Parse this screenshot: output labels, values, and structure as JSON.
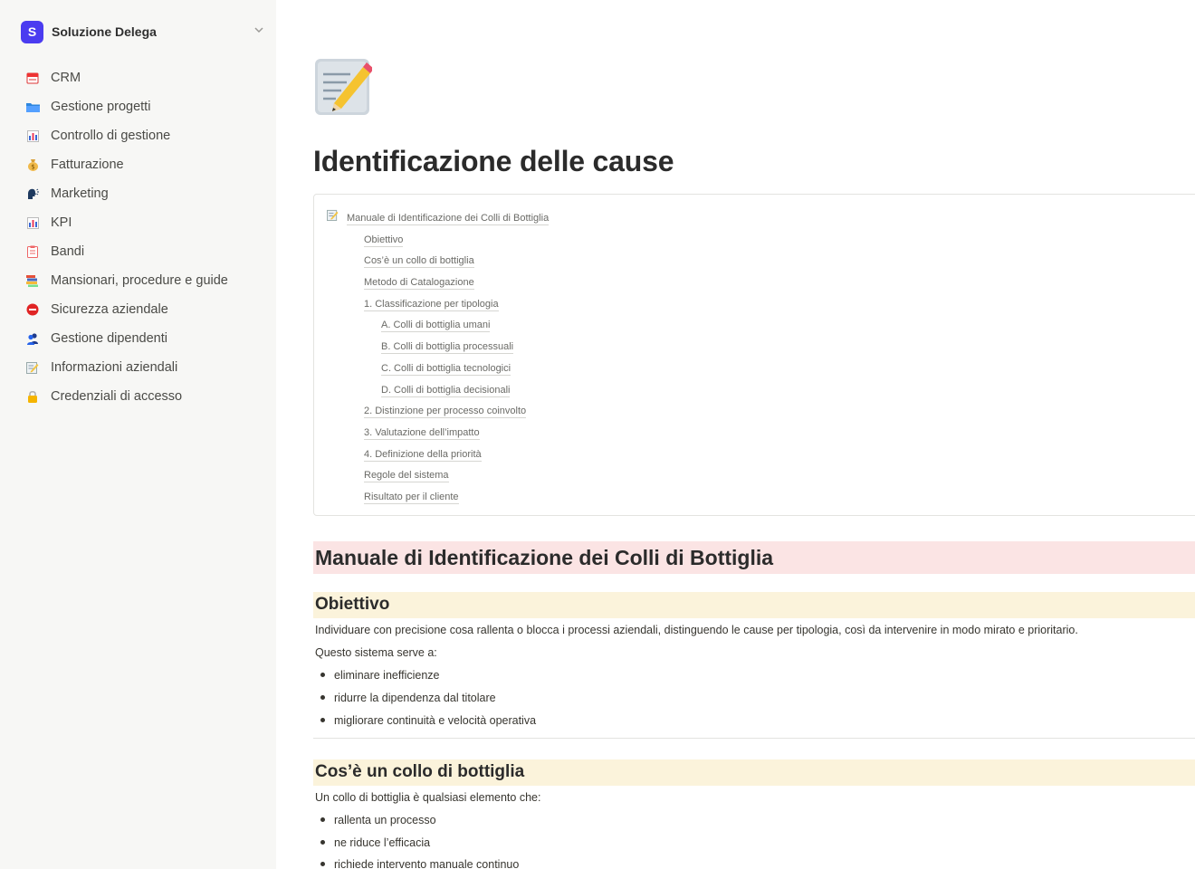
{
  "workspace": {
    "logo": "S",
    "name": "Soluzione Delega"
  },
  "sidebar": {
    "items": [
      {
        "label": "CRM",
        "icon": "calendar-icon"
      },
      {
        "label": "Gestione progetti",
        "icon": "folder-icon"
      },
      {
        "label": "Controllo di gestione",
        "icon": "bar-chart-icon"
      },
      {
        "label": "Fatturazione",
        "icon": "money-bag-icon"
      },
      {
        "label": "Marketing",
        "icon": "speaking-head-icon"
      },
      {
        "label": "KPI",
        "icon": "bar-chart-icon"
      },
      {
        "label": "Bandi",
        "icon": "clipboard-icon"
      },
      {
        "label": "Mansionari, procedure e guide",
        "icon": "books-icon"
      },
      {
        "label": "Sicurezza aziendale",
        "icon": "no-entry-icon"
      },
      {
        "label": "Gestione dipendenti",
        "icon": "people-icon"
      },
      {
        "label": "Informazioni aziendali",
        "icon": "memo-icon"
      },
      {
        "label": "Credenziali di accesso",
        "icon": "lock-icon"
      }
    ]
  },
  "page": {
    "icon": "memo-icon",
    "title": "Identificazione delle cause"
  },
  "toc": {
    "items": [
      {
        "label": "Manuale di Identificazione dei Colli di Bottiglia",
        "level": 0
      },
      {
        "label": "Obiettivo",
        "level": 1
      },
      {
        "label": "Cos’è un collo di bottiglia",
        "level": 1
      },
      {
        "label": "Metodo di Catalogazione",
        "level": 1
      },
      {
        "label": "1. Classificazione per tipologia",
        "level": 1
      },
      {
        "label": "A. Colli di bottiglia umani",
        "level": 2
      },
      {
        "label": "B. Colli di bottiglia processuali",
        "level": 2
      },
      {
        "label": "C. Colli di bottiglia tecnologici",
        "level": 2
      },
      {
        "label": "D. Colli di bottiglia decisionali",
        "level": 2
      },
      {
        "label": "2. Distinzione per processo coinvolto",
        "level": 1
      },
      {
        "label": "3. Valutazione dell’impatto",
        "level": 1
      },
      {
        "label": "4. Definizione della priorità",
        "level": 1
      },
      {
        "label": "Regole del sistema",
        "level": 1
      },
      {
        "label": "Risultato per il cliente",
        "level": 1
      }
    ]
  },
  "content": {
    "h1": "Manuale di Identificazione dei Colli di Bottiglia",
    "obiettivo": {
      "heading": "Obiettivo",
      "para1": "Individuare con precisione cosa rallenta o blocca i processi aziendali, distinguendo le cause per tipologia, così da intervenire in modo mirato e prioritario.",
      "para2": "Questo sistema serve a:",
      "bullets": [
        "eliminare inefficienze",
        "ridurre la dipendenza dal titolare",
        "migliorare continuità e velocità operativa"
      ]
    },
    "collo": {
      "heading": "Cos’è un collo di bottiglia",
      "para1": "Un collo di bottiglia è qualsiasi elemento che:",
      "bullets": [
        "rallenta un processo",
        "ne riduce l’efficacia",
        "richiede intervento manuale continuo"
      ]
    }
  },
  "colors": {
    "sidebar_bg": "#f7f7f5",
    "h1_highlight": "#fbe4e4",
    "h2_highlight": "#fbf3db",
    "logo_bg": "#4b3cf0"
  }
}
